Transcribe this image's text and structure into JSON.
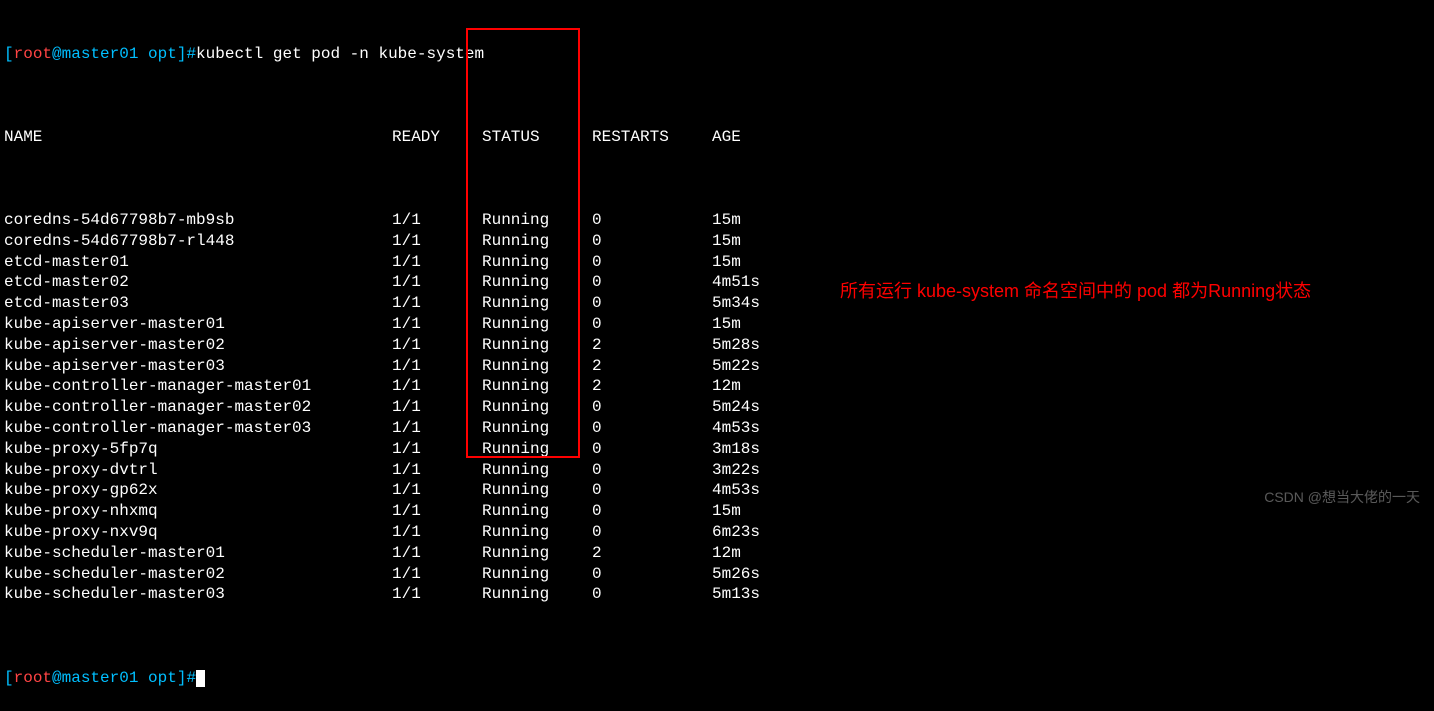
{
  "prompt1": {
    "user": "root",
    "at": "@",
    "host": "master01",
    "path": " opt",
    "command": "kubectl get pod -n kube-system"
  },
  "prompt2": {
    "user": "root",
    "at": "@",
    "host": "master01",
    "path": " opt"
  },
  "headers": {
    "name": "NAME",
    "ready": "READY",
    "status": "STATUS",
    "restarts": "RESTARTS",
    "age": "AGE"
  },
  "rows": [
    {
      "name": "coredns-54d67798b7-mb9sb",
      "ready": "1/1",
      "status": "Running",
      "restarts": "0",
      "age": "15m"
    },
    {
      "name": "coredns-54d67798b7-rl448",
      "ready": "1/1",
      "status": "Running",
      "restarts": "0",
      "age": "15m"
    },
    {
      "name": "etcd-master01",
      "ready": "1/1",
      "status": "Running",
      "restarts": "0",
      "age": "15m"
    },
    {
      "name": "etcd-master02",
      "ready": "1/1",
      "status": "Running",
      "restarts": "0",
      "age": "4m51s"
    },
    {
      "name": "etcd-master03",
      "ready": "1/1",
      "status": "Running",
      "restarts": "0",
      "age": "5m34s"
    },
    {
      "name": "kube-apiserver-master01",
      "ready": "1/1",
      "status": "Running",
      "restarts": "0",
      "age": "15m"
    },
    {
      "name": "kube-apiserver-master02",
      "ready": "1/1",
      "status": "Running",
      "restarts": "2",
      "age": "5m28s"
    },
    {
      "name": "kube-apiserver-master03",
      "ready": "1/1",
      "status": "Running",
      "restarts": "2",
      "age": "5m22s"
    },
    {
      "name": "kube-controller-manager-master01",
      "ready": "1/1",
      "status": "Running",
      "restarts": "2",
      "age": "12m"
    },
    {
      "name": "kube-controller-manager-master02",
      "ready": "1/1",
      "status": "Running",
      "restarts": "0",
      "age": "5m24s"
    },
    {
      "name": "kube-controller-manager-master03",
      "ready": "1/1",
      "status": "Running",
      "restarts": "0",
      "age": "4m53s"
    },
    {
      "name": "kube-proxy-5fp7q",
      "ready": "1/1",
      "status": "Running",
      "restarts": "0",
      "age": "3m18s"
    },
    {
      "name": "kube-proxy-dvtrl",
      "ready": "1/1",
      "status": "Running",
      "restarts": "0",
      "age": "3m22s"
    },
    {
      "name": "kube-proxy-gp62x",
      "ready": "1/1",
      "status": "Running",
      "restarts": "0",
      "age": "4m53s"
    },
    {
      "name": "kube-proxy-nhxmq",
      "ready": "1/1",
      "status": "Running",
      "restarts": "0",
      "age": "15m"
    },
    {
      "name": "kube-proxy-nxv9q",
      "ready": "1/1",
      "status": "Running",
      "restarts": "0",
      "age": "6m23s"
    },
    {
      "name": "kube-scheduler-master01",
      "ready": "1/1",
      "status": "Running",
      "restarts": "2",
      "age": "12m"
    },
    {
      "name": "kube-scheduler-master02",
      "ready": "1/1",
      "status": "Running",
      "restarts": "0",
      "age": "5m26s"
    },
    {
      "name": "kube-scheduler-master03",
      "ready": "1/1",
      "status": "Running",
      "restarts": "0",
      "age": "5m13s"
    }
  ],
  "annotation": "所有运行 kube-system 命名空间中的 pod 都为Running状态",
  "watermark": "CSDN @想当大佬的一天"
}
